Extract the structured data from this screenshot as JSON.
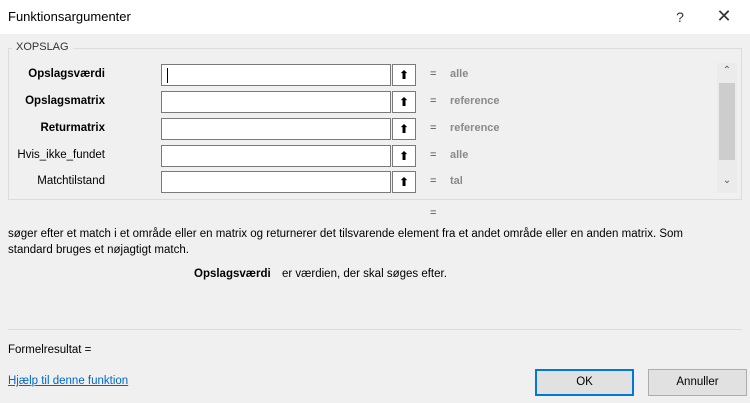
{
  "window": {
    "title": "Funktionsargumenter",
    "help_glyph": "?",
    "close_glyph": "✕"
  },
  "function_name": "XOPSLAG",
  "arguments": [
    {
      "label": "Opslagsværdi",
      "bold": true,
      "value": "",
      "equals": "=",
      "hint": "alle"
    },
    {
      "label": "Opslagsmatrix",
      "bold": true,
      "value": "",
      "equals": "=",
      "hint": "reference"
    },
    {
      "label": "Returmatrix",
      "bold": true,
      "value": "",
      "equals": "=",
      "hint": "reference"
    },
    {
      "label": "Hvis_ikke_fundet",
      "bold": false,
      "value": "",
      "equals": "=",
      "hint": "alle"
    },
    {
      "label": "Matchtilstand",
      "bold": false,
      "value": "",
      "equals": "=",
      "hint": "tal"
    }
  ],
  "ref_button_glyph": "⬆",
  "result_equals": "=",
  "description": "søger efter et match i et område eller en matrix og returnerer det tilsvarende element fra et andet område eller en anden matrix. Som standard bruges et nøjagtigt match.",
  "argument_help": {
    "name": "Opslagsværdi",
    "text": "er værdien, der skal søges efter."
  },
  "formula_result": "Formelresultat =",
  "help_link": "Hjælp til denne funktion",
  "buttons": {
    "ok": "OK",
    "cancel": "Annuller"
  },
  "colors": {
    "accent": "#0078d7",
    "link": "#0066cc",
    "background": "#f0f0f0"
  }
}
